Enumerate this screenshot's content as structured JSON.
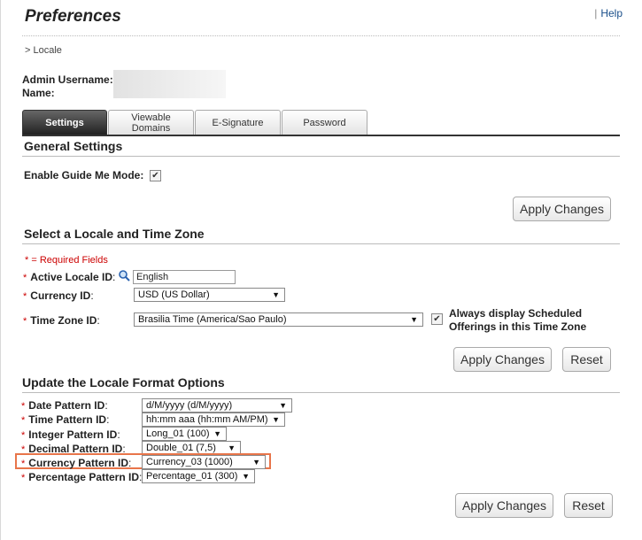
{
  "page": {
    "title": "Preferences",
    "help": "Help",
    "help_sep": "|"
  },
  "breadcrumb": "> Locale",
  "admin": {
    "label": "Admin Username: Name:"
  },
  "tabs": [
    {
      "label": "Settings"
    },
    {
      "label": "Viewable Domains"
    },
    {
      "label": "E-Signature"
    },
    {
      "label": "Password"
    }
  ],
  "general": {
    "heading": "General Settings",
    "guide_label": "Enable Guide Me Mode:",
    "guide_checked": "✔",
    "apply": "Apply Changes"
  },
  "locale": {
    "heading": "Select a Locale and Time Zone",
    "required_note": "* = Required Fields",
    "active_locale_label": "Active Locale ID",
    "active_locale_value": "English",
    "currency_label": "Currency ID",
    "currency_value": "USD (US Dollar)",
    "timezone_label": "Time Zone ID",
    "timezone_value": "Brasilia Time (America/Sao Paulo)",
    "always_display": "Always display Scheduled Offerings in this Time Zone",
    "always_checked": "✔",
    "apply": "Apply Changes",
    "reset": "Reset"
  },
  "format": {
    "heading": "Update the Locale Format Options",
    "date_label": "Date Pattern ID",
    "date_value": "d/M/yyyy (d/M/yyyy)",
    "time_label": "Time Pattern ID",
    "time_value": "hh:mm aaa (hh:mm AM/PM)",
    "integer_label": "Integer Pattern ID",
    "integer_value": "Long_01 (100)",
    "decimal_label": "Decimal Pattern ID",
    "decimal_value": "Double_01 (7,5)",
    "currency_label": "Currency Pattern ID",
    "currency_value": "Currency_03 (1000)",
    "percentage_label": "Percentage Pattern ID",
    "percentage_value": "Percentage_01 (300)",
    "apply": "Apply Changes",
    "reset": "Reset"
  },
  "colors": {
    "highlight": "#e8754a",
    "required": "#cc0000",
    "active_tab": "#333333"
  }
}
